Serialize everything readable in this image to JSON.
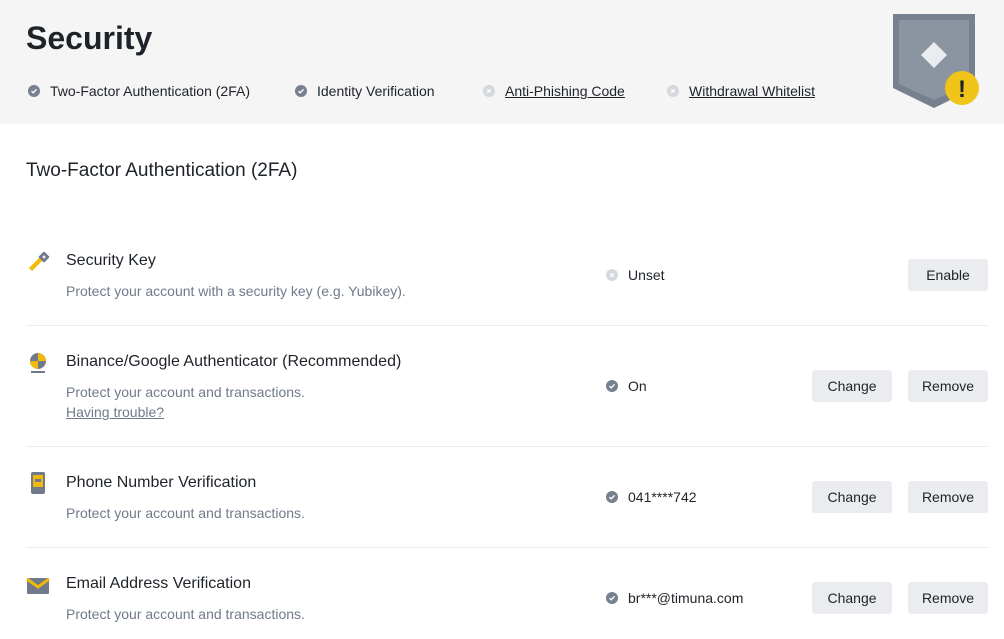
{
  "header": {
    "title": "Security",
    "status_items": [
      {
        "label": "Two-Factor Authentication (2FA)",
        "state": "done",
        "icon": "check-circle-icon"
      },
      {
        "label": "Identity Verification",
        "state": "done",
        "icon": "check-circle-icon"
      },
      {
        "label": "Anti-Phishing Code",
        "state": "not-set",
        "icon": "x-circle-icon"
      },
      {
        "label": "Withdrawal Whitelist",
        "state": "not-set",
        "icon": "x-circle-icon"
      }
    ],
    "badge": {
      "icon": "shield-warning-icon",
      "warning_mark": "!"
    }
  },
  "section": {
    "title": "Two-Factor Authentication (2FA)",
    "rows": [
      {
        "title": "Security Key",
        "description": "Protect your account with a security key (e.g. Yubikey).",
        "icon": "security-key-icon",
        "status": "Unset",
        "status_state": "not-set",
        "buttons": [
          "Enable"
        ]
      },
      {
        "title": "Binance/Google Authenticator (Recommended)",
        "description": "Protect your account and transactions.",
        "link": "Having trouble?",
        "icon": "authenticator-icon",
        "status": "On",
        "status_state": "done",
        "buttons": [
          "Change",
          "Remove"
        ]
      },
      {
        "title": "Phone Number Verification",
        "description": "Protect your account and transactions.",
        "icon": "phone-icon",
        "status": "041****742",
        "status_state": "done",
        "buttons": [
          "Change",
          "Remove"
        ]
      },
      {
        "title": "Email Address Verification",
        "description": "Protect your account and transactions.",
        "icon": "email-icon",
        "status": "br***@timuna.com",
        "status_state": "done",
        "buttons": [
          "Change",
          "Remove"
        ]
      }
    ]
  },
  "colors": {
    "accent": "#f0b90b",
    "header_bg": "#f5f5f5",
    "button_bg": "#eaecef",
    "muted_text": "#707a8a",
    "check_done": "#76808f",
    "check_unset": "#d5d8dc"
  }
}
